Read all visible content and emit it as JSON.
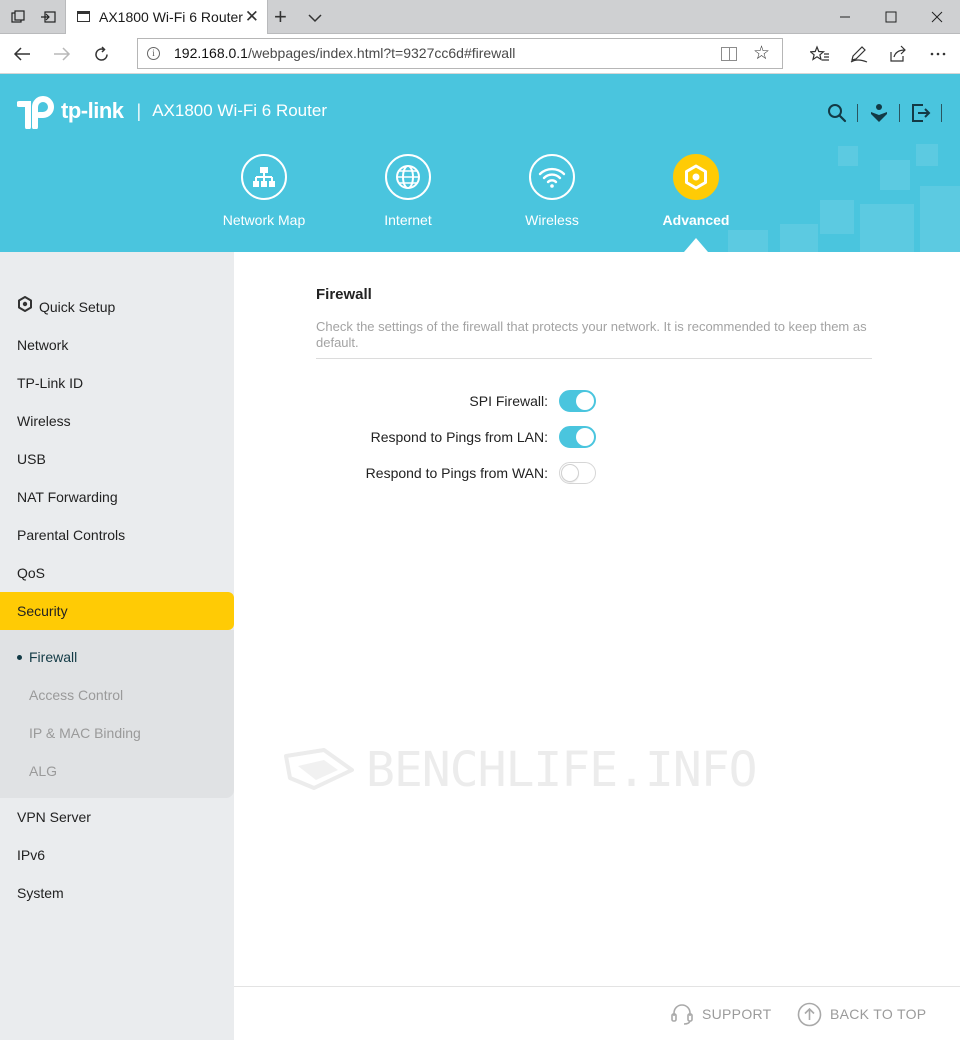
{
  "browser": {
    "tab_title": "AX1800 Wi-Fi 6 Router",
    "url_host": "192.168.0.1",
    "url_path": "/webpages/index.html?t=9327cc6d#firewall"
  },
  "header": {
    "brand": "tp-link",
    "separator": "|",
    "model": "AX1800 Wi-Fi 6 Router",
    "nav": [
      {
        "label": "Network Map",
        "icon": "network-map-icon"
      },
      {
        "label": "Internet",
        "icon": "globe-icon"
      },
      {
        "label": "Wireless",
        "icon": "wifi-icon"
      },
      {
        "label": "Advanced",
        "icon": "gear-icon",
        "active": true
      }
    ],
    "accent_color": "#4ac5de",
    "active_color": "#ffcb05"
  },
  "sidebar": {
    "items": [
      {
        "label": "Quick Setup",
        "icon": "gear-icon"
      },
      {
        "label": "Network"
      },
      {
        "label": "TP-Link ID"
      },
      {
        "label": "Wireless"
      },
      {
        "label": "USB"
      },
      {
        "label": "NAT Forwarding"
      },
      {
        "label": "Parental Controls"
      },
      {
        "label": "QoS"
      },
      {
        "label": "Security",
        "active": true
      },
      {
        "label": "VPN Server"
      },
      {
        "label": "IPv6"
      },
      {
        "label": "System"
      }
    ],
    "security_sub": [
      {
        "label": "Firewall",
        "active": true
      },
      {
        "label": "Access Control"
      },
      {
        "label": "IP & MAC Binding"
      },
      {
        "label": "ALG"
      }
    ]
  },
  "content": {
    "title": "Firewall",
    "description": "Check the settings of the firewall that protects your network. It is recommended to keep them as default.",
    "settings": [
      {
        "label": "SPI Firewall:",
        "enabled": true
      },
      {
        "label": "Respond to Pings from LAN:",
        "enabled": true
      },
      {
        "label": "Respond to Pings from WAN:",
        "enabled": false
      }
    ]
  },
  "watermark": "BENCHLIFE.INFO",
  "footer": {
    "support": "SUPPORT",
    "back_to_top": "BACK TO TOP"
  }
}
